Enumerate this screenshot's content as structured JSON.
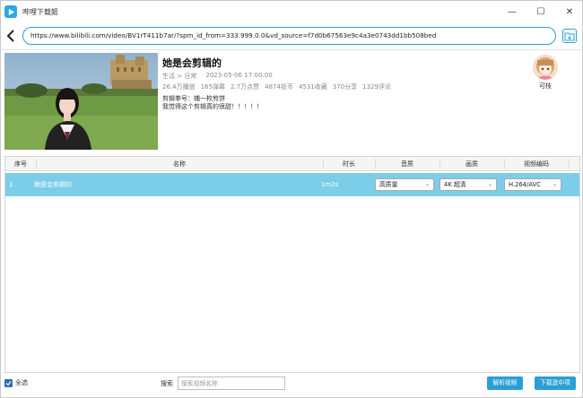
{
  "window": {
    "title": "哔哩下载姬",
    "minimize_glyph": "—",
    "maximize_glyph": "☐",
    "close_glyph": "✕"
  },
  "url_bar": {
    "url": "https://www.bilibili.com/video/BV1rT411b7ar/?spm_id_from=333.999.0.0&vd_source=f7d0b67563e9c4a3e0743dd1bb508bed"
  },
  "video": {
    "title": "她是会剪辑的",
    "category": "生活 > 日常",
    "publish_time": "2023-05-06 17:00:00",
    "stats": [
      "26.4万播放",
      "165弹幕",
      "2.7万点赞",
      "4874投币",
      "4531收藏",
      "370分享",
      "1329评论"
    ],
    "description_line1": "剪辑拳号：捕一枚煎饼",
    "description_line2": "我觉得这个剪辑真的很甜！！！！！"
  },
  "uploader": {
    "name": "可枝"
  },
  "table": {
    "columns": [
      "序号",
      "名称",
      "时长",
      "音质",
      "画质",
      "视频编码"
    ],
    "rows": [
      {
        "index": "1",
        "name": "她是会剪辑的",
        "duration": "1m2s",
        "audio_quality": "高质量",
        "video_quality": "4K 超清",
        "codec": "H.264/AVC"
      }
    ]
  },
  "footer": {
    "select_all_label": "全选",
    "search_label": "搜索",
    "search_placeholder": "搜索视频名称",
    "parse_button": "解析视频",
    "download_button": "下载选中项"
  },
  "colors": {
    "accent": "#2a9fd6",
    "selected_row": "#7ccde8"
  }
}
